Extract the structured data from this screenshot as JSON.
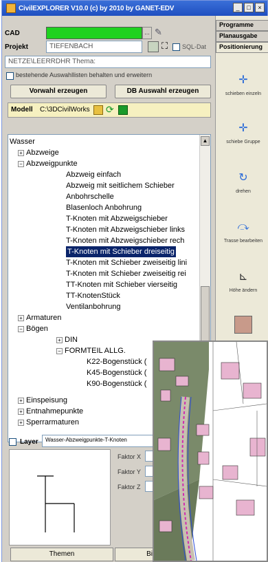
{
  "window": {
    "title": "CivilEXPLORER V10.0 (c) by 2010 by GANET-EDV",
    "min": "_",
    "max": "□",
    "close": "×"
  },
  "cad": {
    "label": "CAD"
  },
  "projekt": {
    "label": "Projekt",
    "value": "TIEFENBACH",
    "sql_label": "SQL-Dat"
  },
  "thema": {
    "value": "NETZE\\LEERRDHR  Thema:"
  },
  "checkbox_label": "bestehende Auswahllisten behalten und erweitern",
  "buttons": {
    "vorwahl": "Vorwahl erzeugen",
    "db_auswahl": "DB Auswahl erzeugen"
  },
  "modell": {
    "label": "Modell",
    "path": "C:\\3DCivilWorks"
  },
  "tree": [
    {
      "text": "Wasser"
    },
    {
      "text": "Abzweige"
    },
    {
      "text": "Abzweigpunkte"
    },
    {
      "text": "Abzweig einfach"
    },
    {
      "text": "Abzweig mit seitlichem Schieber"
    },
    {
      "text": "Anbohrschelle"
    },
    {
      "text": "Blasenloch Anbohrung"
    },
    {
      "text": "T-Knoten mit Abzweigschieber"
    },
    {
      "text": "T-Knoten mit Abzweigschieber links"
    },
    {
      "text": "T-Knoten mit Abzweigschieber rech"
    },
    {
      "text": "T-Knoten mit Schieber dreiseitig"
    },
    {
      "text": "T-Knoten mit Schieber zweiseitig lini"
    },
    {
      "text": "T-Knoten mit Schieber zweiseitig rei"
    },
    {
      "text": "TT-Knoten mit Schieber vierseitig"
    },
    {
      "text": "TT-KnotenStück"
    },
    {
      "text": "Ventilanbohrung"
    },
    {
      "text": "Armaturen"
    },
    {
      "text": "Bögen"
    },
    {
      "text": "DIN"
    },
    {
      "text": "FORMTEIL ALLG."
    },
    {
      "text": "K22-Bogenstück ("
    },
    {
      "text": "K45-Bogenstück ("
    },
    {
      "text": "K90-Bogenstück ("
    },
    {
      "text": "Einspeisung"
    },
    {
      "text": "Entnahmepunkte"
    },
    {
      "text": "Sperrarmaturen"
    }
  ],
  "layer": {
    "label": "Layer",
    "value": "Wasser-Abzweigpunkte-T-Knoten"
  },
  "faktor": {
    "x": "Faktor X",
    "y": "Faktor Y",
    "z": "Faktor Z"
  },
  "bottom_tabs": {
    "themen": "Themen",
    "bi": "Bi"
  },
  "right_tabs": {
    "programme": "Programme",
    "planausgabe": "Planausgabe",
    "positionierung": "Positionierung"
  },
  "tools": [
    {
      "label": "schieben einzeln",
      "icon": "move-single-icon"
    },
    {
      "label": "schiebe Gruppe",
      "icon": "move-group-icon"
    },
    {
      "label": "drehen",
      "icon": "rotate-icon"
    },
    {
      "label": "Trasse bearbeiten",
      "icon": "route-edit-icon"
    },
    {
      "label": "Höhe ändern",
      "icon": "height-icon"
    },
    {
      "label": "",
      "icon": "image-icon"
    }
  ]
}
